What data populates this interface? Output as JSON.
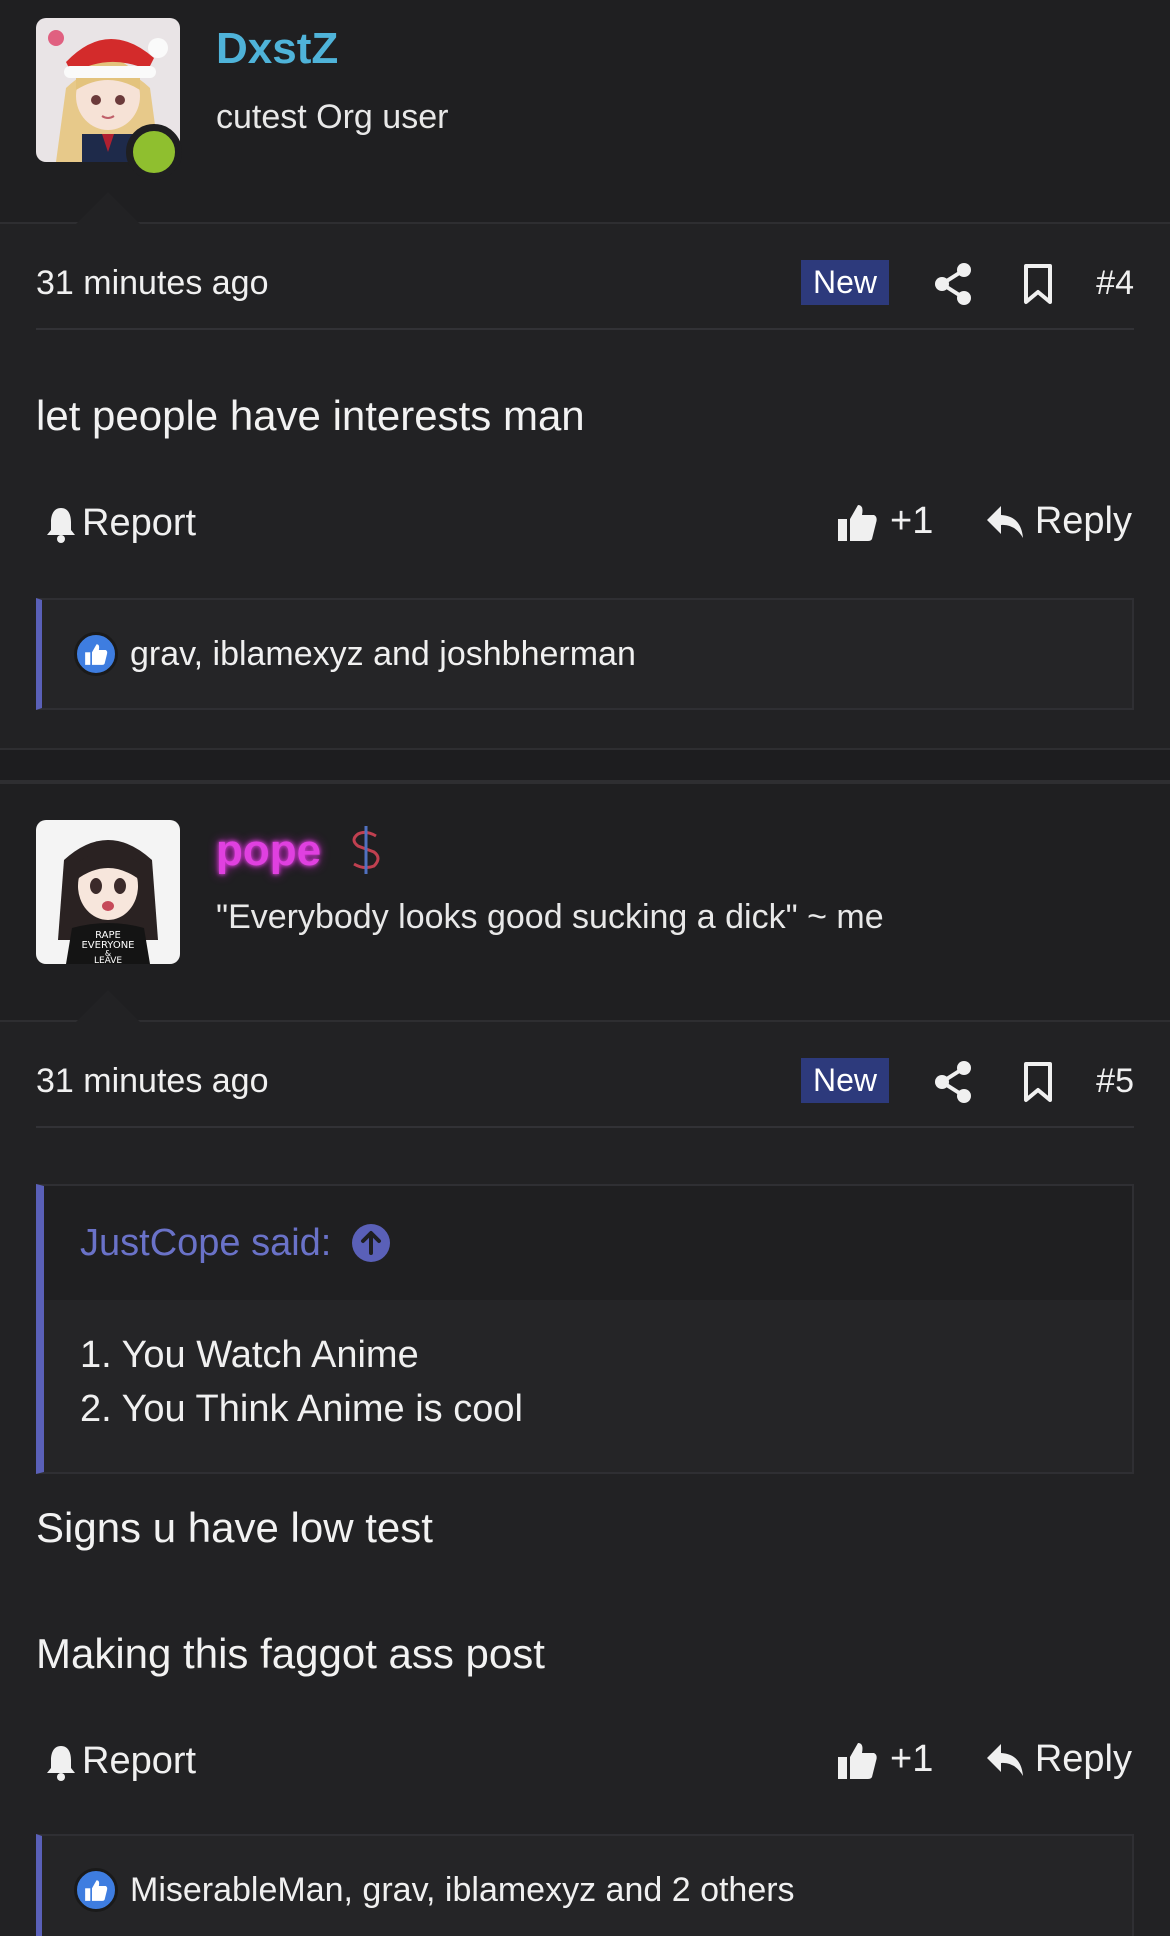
{
  "posts": [
    {
      "username": "DxstZ",
      "username_color": "#4fb3d9",
      "user_title": "cutest Org user",
      "time": "31 minutes ago",
      "badge": "New",
      "number": "#4",
      "body": [
        "let people have interests man"
      ],
      "report_label": "Report",
      "like_count": "+1",
      "reply_label": "Reply",
      "reactions": "grav, iblamexyz and joshbherman",
      "online": true
    },
    {
      "username": "pope",
      "username_color": "#e040e0",
      "user_icon": "dollar-icon",
      "user_title": "\"Everybody looks good sucking a dick\" ~ me",
      "time": "31 minutes ago",
      "badge": "New",
      "number": "#5",
      "quote": {
        "author": "JustCope said:",
        "lines": [
          "1. You Watch Anime",
          "2. You Think Anime is cool"
        ]
      },
      "body": [
        "Signs u have low test",
        "Making this faggot ass post"
      ],
      "report_label": "Report",
      "like_count": "+1",
      "reply_label": "Reply",
      "reactions": "MiserableMan, grav, iblamexyz and 2 others",
      "avatar_shirt_text": [
        "RAPE",
        "EVERYONE",
        "&",
        "LEAVE"
      ]
    }
  ],
  "colors": {
    "accent": "#5a60b8",
    "badge_bg": "#2d3a7c",
    "online": "#8fbf2f",
    "reaction_like": "#3e7de0"
  }
}
